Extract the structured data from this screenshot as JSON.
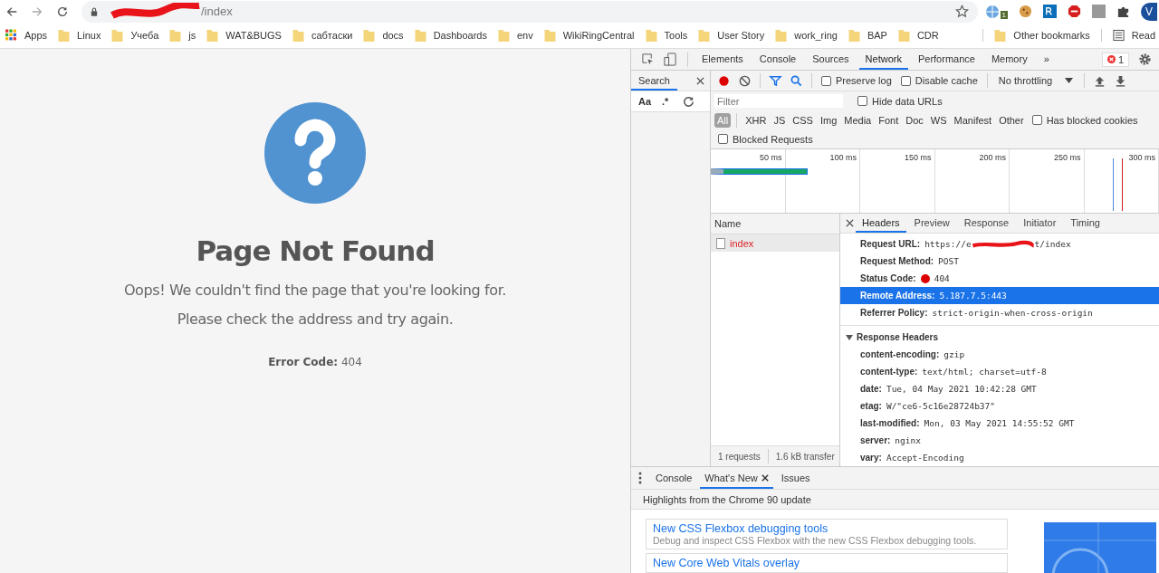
{
  "browser": {
    "address": {
      "visible_url": "/index",
      "redacted": true
    },
    "extension_badge": "1",
    "profile_initial": "V",
    "bookmarks": [
      {
        "label": "Apps",
        "kind": "apps"
      },
      {
        "label": "Linux",
        "kind": "folder"
      },
      {
        "label": "Учеба",
        "kind": "folder"
      },
      {
        "label": "js",
        "kind": "folder"
      },
      {
        "label": "WAT&BUGS",
        "kind": "folder"
      },
      {
        "label": "сабтаски",
        "kind": "folder"
      },
      {
        "label": "docs",
        "kind": "folder"
      },
      {
        "label": "Dashboards",
        "kind": "folder"
      },
      {
        "label": "env",
        "kind": "folder"
      },
      {
        "label": "WikiRingCentral",
        "kind": "folder"
      },
      {
        "label": "Tools",
        "kind": "folder"
      },
      {
        "label": "User Story",
        "kind": "folder"
      },
      {
        "label": "work_ring",
        "kind": "folder"
      },
      {
        "label": "BAP",
        "kind": "folder"
      },
      {
        "label": "CDR",
        "kind": "folder"
      }
    ],
    "other_bookmarks": "Other bookmarks",
    "reading_list": "Read"
  },
  "page": {
    "title": "Page Not Found",
    "messages": [
      "Oops! We couldn't find the page that you're looking for.",
      "Please check the address and try again."
    ],
    "error_label": "Error Code:",
    "error_value": "404"
  },
  "devtools": {
    "tabs": [
      {
        "label": "Elements",
        "selected": false
      },
      {
        "label": "Console",
        "selected": false
      },
      {
        "label": "Sources",
        "selected": false
      },
      {
        "label": "Network",
        "selected": true
      },
      {
        "label": "Performance",
        "selected": false
      },
      {
        "label": "Memory",
        "selected": false
      }
    ],
    "more": "»",
    "error_count": "1",
    "search_panel": {
      "tab": "Search",
      "selected": true,
      "match_case": "Aa",
      "regex": ".*"
    },
    "network_toolbar": {
      "recording": true,
      "preserve_log": {
        "label": "Preserve log",
        "checked": false
      },
      "disable_cache": {
        "label": "Disable cache",
        "checked": false
      },
      "throttling": "No throttling"
    },
    "filter": {
      "placeholder": "Filter",
      "hide_data_urls": {
        "label": "Hide data URLs",
        "checked": false
      },
      "types": [
        {
          "label": "All",
          "selected": true
        },
        {
          "label": "XHR",
          "selected": false
        },
        {
          "label": "JS",
          "selected": false
        },
        {
          "label": "CSS",
          "selected": false
        },
        {
          "label": "Img",
          "selected": false
        },
        {
          "label": "Media",
          "selected": false
        },
        {
          "label": "Font",
          "selected": false
        },
        {
          "label": "Doc",
          "selected": false
        },
        {
          "label": "WS",
          "selected": false
        },
        {
          "label": "Manifest",
          "selected": false
        },
        {
          "label": "Other",
          "selected": false
        }
      ],
      "has_blocked_cookies": {
        "label": "Has blocked cookies",
        "checked": false
      },
      "blocked_requests": {
        "label": "Blocked Requests",
        "checked": false
      }
    },
    "overview_ticks": [
      "50 ms",
      "100 ms",
      "150 ms",
      "200 ms",
      "250 ms",
      "300 ms"
    ],
    "requests": {
      "column": "Name",
      "rows": [
        {
          "name": "index",
          "selected": true,
          "failed": true
        }
      ],
      "summary": [
        "1 requests",
        "1.6 kB transfer"
      ]
    },
    "detail_tabs": [
      {
        "label": "Headers",
        "selected": true
      },
      {
        "label": "Preview",
        "selected": false
      },
      {
        "label": "Response",
        "selected": false
      },
      {
        "label": "Initiator",
        "selected": false
      },
      {
        "label": "Timing",
        "selected": false
      }
    ],
    "general": [
      {
        "key": "Request URL:",
        "kind": "redacted",
        "parts": [
          "https://e",
          "t/index"
        ],
        "selected": false
      },
      {
        "key": "Request Method:",
        "kind": "text",
        "value": "POST",
        "selected": false
      },
      {
        "key": "Status Code:",
        "kind": "status",
        "value": "404",
        "selected": false
      },
      {
        "key": "Remote Address:",
        "kind": "text",
        "value": "5.187.7.5:443",
        "selected": true
      },
      {
        "key": "Referrer Policy:",
        "kind": "text",
        "value": "strict-origin-when-cross-origin",
        "selected": false
      }
    ],
    "response_headers": {
      "title": "Response Headers",
      "expanded": true,
      "items": [
        {
          "key": "content-encoding:",
          "value": "gzip"
        },
        {
          "key": "content-type:",
          "value": "text/html; charset=utf-8"
        },
        {
          "key": "date:",
          "value": "Tue, 04 May 2021 10:42:28 GMT"
        },
        {
          "key": "etag:",
          "value": "W/\"ce6-5c16e28724b37\""
        },
        {
          "key": "last-modified:",
          "value": "Mon, 03 May 2021 14:55:52 GMT"
        },
        {
          "key": "server:",
          "value": "nginx"
        },
        {
          "key": "vary:",
          "value": "Accept-Encoding"
        }
      ]
    },
    "drawer": {
      "tabs": [
        {
          "label": "Console",
          "selected": false,
          "closable": false
        },
        {
          "label": "What's New",
          "selected": true,
          "closable": true
        },
        {
          "label": "Issues",
          "selected": false,
          "closable": false
        }
      ],
      "highlight": "Highlights from the Chrome 90 update",
      "cards": [
        {
          "title": "New CSS Flexbox debugging tools",
          "description": "Debug and inspect CSS Flexbox with the new CSS Flexbox debugging tools."
        },
        {
          "title": "New Core Web Vitals overlay"
        }
      ]
    }
  }
}
